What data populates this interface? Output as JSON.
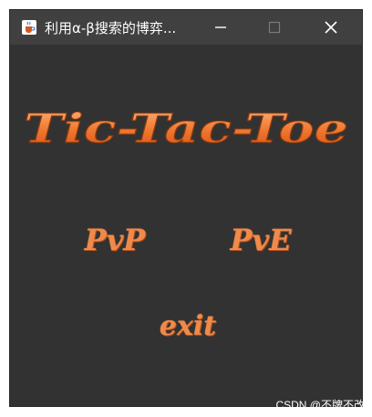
{
  "window": {
    "title": "利用α-β搜索的博弈...",
    "app_icon": "java-coffee-cup-icon"
  },
  "titlebar_buttons": {
    "minimize": "minimize-icon",
    "maximize": "maximize-icon",
    "close": "close-icon"
  },
  "logo": {
    "text": "Tic-Tac-Toe"
  },
  "menu": {
    "pvp_label": "PvP",
    "pve_label": "PvE",
    "exit_label": "exit"
  },
  "watermark": "CSDN @不牌不改",
  "colors": {
    "background": "#323232",
    "titlebar": "#404040",
    "accent_orange": "#f08a4b",
    "logo_orange": "#e8641e"
  }
}
